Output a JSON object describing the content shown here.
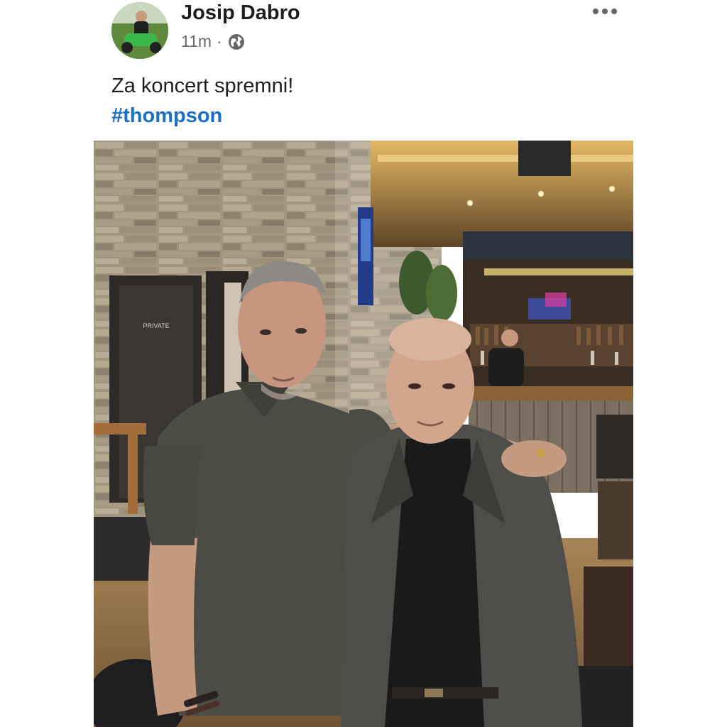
{
  "post": {
    "author": {
      "name": "Josip Dabro"
    },
    "meta": {
      "time": "11m",
      "separator": "·",
      "audience_icon": "globe-icon"
    },
    "more_icon": "more-horizontal-icon",
    "text": "Za koncert spremni!",
    "hashtag": "#thompson",
    "photo": {
      "door_sign": "PRIVATE"
    }
  },
  "colors": {
    "text": "#1c1e21",
    "secondary_text": "#65676b",
    "hashtag": "#1b6ec2"
  }
}
